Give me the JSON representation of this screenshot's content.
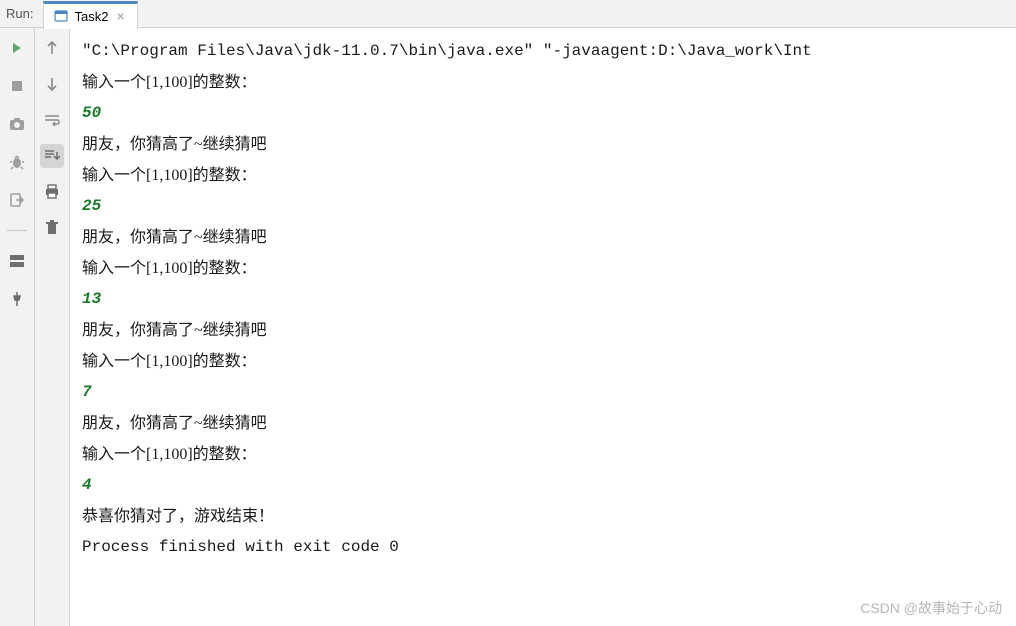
{
  "header": {
    "run_label": "Run:",
    "tab_label": "Task2",
    "tab_close": "×"
  },
  "console": {
    "command": "\"C:\\Program Files\\Java\\jdk-11.0.7\\bin\\java.exe\" \"-javaagent:D:\\Java_work\\Int",
    "rounds": [
      {
        "prompt": "输入一个[1,100]的整数：",
        "guess": "50",
        "feedback": "朋友，你猜高了~继续猜吧"
      },
      {
        "prompt": "输入一个[1,100]的整数：",
        "guess": "25",
        "feedback": "朋友，你猜高了~继续猜吧"
      },
      {
        "prompt": "输入一个[1,100]的整数：",
        "guess": "13",
        "feedback": "朋友，你猜高了~继续猜吧"
      },
      {
        "prompt": "输入一个[1,100]的整数：",
        "guess": "7",
        "feedback": "朋友，你猜高了~继续猜吧"
      },
      {
        "prompt": "输入一个[1,100]的整数：",
        "guess": "4",
        "feedback": "恭喜你猜对了，游戏结束！"
      }
    ],
    "exit_line": "Process finished with exit code 0"
  },
  "watermark": "CSDN @故事始于心动"
}
